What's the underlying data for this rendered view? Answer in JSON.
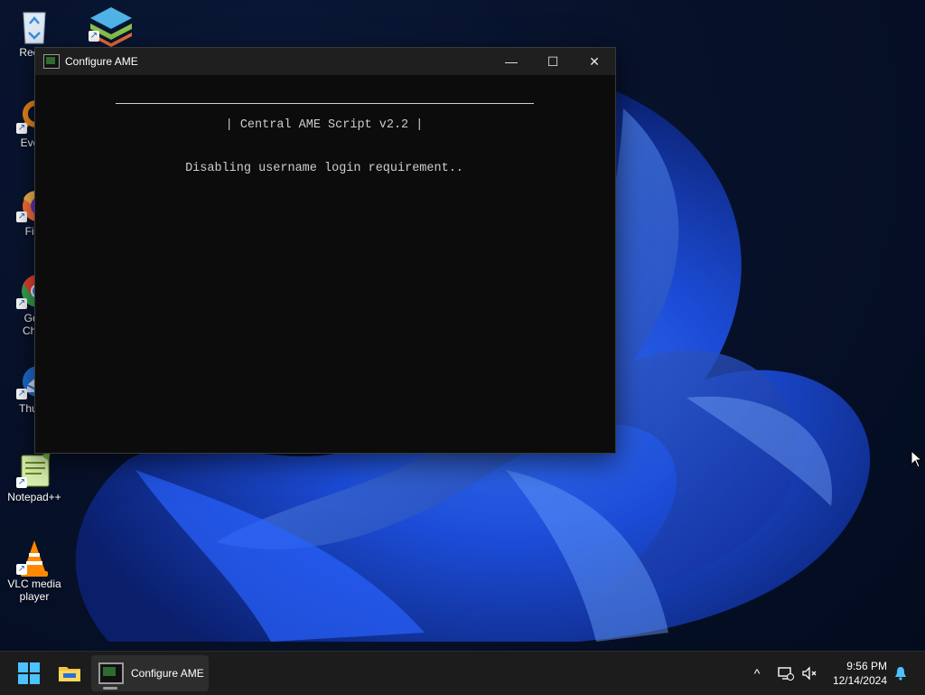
{
  "desktop": {
    "icons": [
      {
        "label": "Recycle Bin",
        "icon": "recycle-bin-icon"
      },
      {
        "label": "",
        "icon": "layers-app-icon"
      },
      {
        "label": "Everything",
        "icon": "everything-search-icon"
      },
      {
        "label": "Firefox",
        "icon": "firefox-icon"
      },
      {
        "label": "Google Chrome",
        "icon": "chrome-icon"
      },
      {
        "label": "Thunderbird",
        "icon": "thunderbird-icon"
      },
      {
        "label": "Notepad++",
        "icon": "notepadpp-icon"
      },
      {
        "label": "VLC media player",
        "icon": "vlc-icon"
      }
    ],
    "visible_labels": {
      "recycle": "Recyc",
      "everything": "Every",
      "firefox": "Fire",
      "chrome_1": "Goo",
      "chrome_2": "Chro",
      "thunderbird": "Thund",
      "notepad": "Notepad++",
      "vlc_1": "VLC media",
      "vlc_2": "player"
    }
  },
  "window": {
    "title": "Configure AME",
    "controls": {
      "minimize": "—",
      "maximize": "☐",
      "close": "✕"
    },
    "console": {
      "header": "| Central AME Script v2.2 |",
      "status": "Disabling username login requirement.."
    }
  },
  "taskbar": {
    "task_label": "Configure AME",
    "tray": {
      "chevron": "^",
      "time": "9:56 PM",
      "date": "12/14/2024"
    }
  },
  "colors": {
    "console_bg": "#0c0c0c",
    "console_text": "#cccccc",
    "taskbar_bg": "#1c1c1c",
    "wallpaper_blue": "#1a4de8"
  }
}
